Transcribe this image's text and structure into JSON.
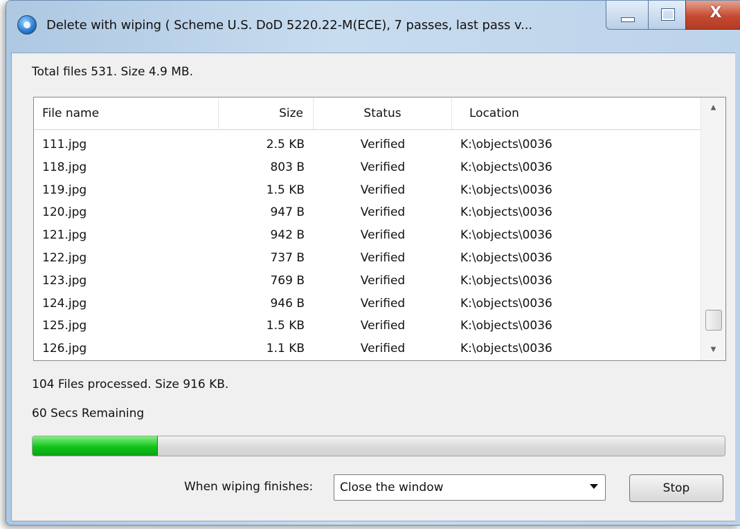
{
  "window": {
    "title": "Delete with wiping ( Scheme U.S. DoD 5220.22-M(ECE), 7 passes, last pass v...",
    "close_glyph": "X",
    "icons": [
      "app-icon",
      "minimize-icon",
      "maximize-icon",
      "close-icon"
    ]
  },
  "summary": {
    "total": "Total files 531. Size 4.9 MB."
  },
  "table": {
    "columns": [
      "File name",
      "Size",
      "Status",
      "Location"
    ],
    "rows": [
      [
        "111.jpg",
        "2.5 KB",
        "Verified",
        "K:\\objects\\0036"
      ],
      [
        "118.jpg",
        "803 B",
        "Verified",
        "K:\\objects\\0036"
      ],
      [
        "119.jpg",
        "1.5 KB",
        "Verified",
        "K:\\objects\\0036"
      ],
      [
        "120.jpg",
        "947 B",
        "Verified",
        "K:\\objects\\0036"
      ],
      [
        "121.jpg",
        "942 B",
        "Verified",
        "K:\\objects\\0036"
      ],
      [
        "122.jpg",
        "737 B",
        "Verified",
        "K:\\objects\\0036"
      ],
      [
        "123.jpg",
        "769 B",
        "Verified",
        "K:\\objects\\0036"
      ],
      [
        "124.jpg",
        "946 B",
        "Verified",
        "K:\\objects\\0036"
      ],
      [
        "125.jpg",
        "1.5 KB",
        "Verified",
        "K:\\objects\\0036"
      ],
      [
        "126.jpg",
        "1.1 KB",
        "Verified",
        "K:\\objects\\0036"
      ]
    ]
  },
  "status": {
    "processed": "104 Files processed. Size 916 KB.",
    "remaining": "60 Secs Remaining"
  },
  "progress": {
    "fraction": 0.18,
    "color": "#12c21a"
  },
  "footer": {
    "finish_label": "When wiping finishes:",
    "finish_value": "Close the window",
    "stop_label": "Stop"
  }
}
